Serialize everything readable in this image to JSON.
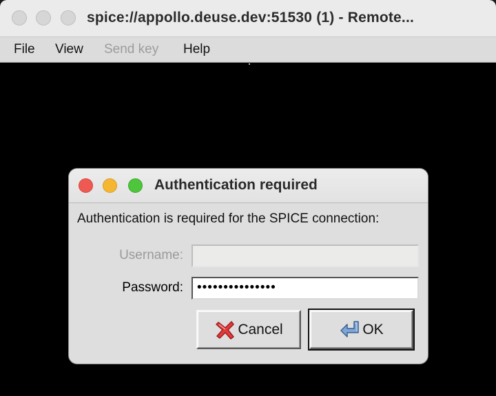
{
  "window": {
    "title": "spice://appollo.deuse.dev:51530 (1) - Remote..."
  },
  "menubar": {
    "items": [
      {
        "label": "File",
        "enabled": true
      },
      {
        "label": "View",
        "enabled": true
      },
      {
        "label": "Send key",
        "enabled": false
      },
      {
        "label": "Help",
        "enabled": true
      }
    ]
  },
  "dialog": {
    "title": "Authentication required",
    "message": "Authentication is required for the SPICE connection:",
    "username": {
      "label": "Username:",
      "value": "",
      "enabled": false
    },
    "password": {
      "label": "Password:",
      "value": "•••••••••••••••",
      "enabled": true
    },
    "buttons": {
      "cancel_label": "Cancel",
      "ok_label": "OK"
    },
    "icons": {
      "cancel": "red-x-icon",
      "ok": "enter-arrow-icon"
    }
  },
  "colors": {
    "traffic_close": "#ee5a52",
    "traffic_minimize": "#f5b632",
    "traffic_maximize": "#4fc43d",
    "inactive_traffic": "#d6d6d6",
    "remote_background": "#000000"
  }
}
